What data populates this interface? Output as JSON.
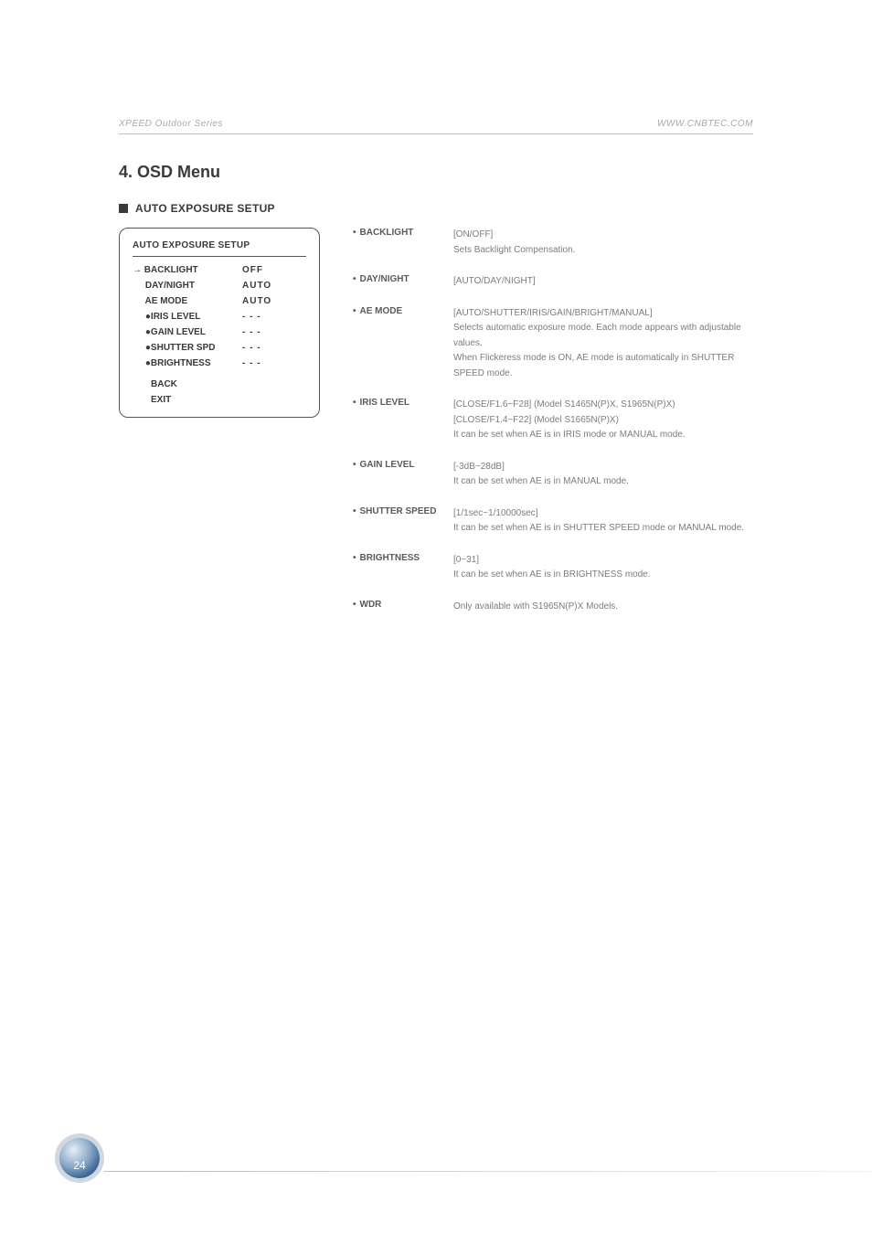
{
  "header": {
    "left": "XPEED Outdoor Series",
    "right": "WWW.CNBTEC.COM"
  },
  "title": "4. OSD Menu",
  "subtitle": "AUTO EXPOSURE SETUP",
  "menu_box": {
    "title": "AUTO EXPOSURE SETUP",
    "rows": [
      {
        "label": "→ BACKLIGHT",
        "value": "OFF"
      },
      {
        "label": "     DAY/NIGHT",
        "value": "AUTO"
      },
      {
        "label": "     AE MODE",
        "value": "AUTO"
      },
      {
        "label": "     ●IRIS LEVEL",
        "value": "- - -"
      },
      {
        "label": "     ●GAIN LEVEL",
        "value": "- - -"
      },
      {
        "label": "     ●SHUTTER SPD",
        "value": "- - -"
      },
      {
        "label": "     ●BRIGHTNESS",
        "value": "- - -"
      }
    ],
    "bottom": [
      {
        "label": "BACK"
      },
      {
        "label": "EXIT"
      }
    ]
  },
  "items": [
    {
      "label": "BACKLIGHT",
      "lines": [
        "[ON/OFF]",
        "Sets Backlight Compensation."
      ]
    },
    {
      "label": "DAY/NIGHT",
      "lines": [
        "[AUTO/DAY/NIGHT]"
      ]
    },
    {
      "label": "AE MODE",
      "lines": [
        "[AUTO/SHUTTER/IRIS/GAIN/BRIGHT/MANUAL]",
        "Selects automatic exposure mode. Each mode appears with adjustable values.",
        "When Flickeress mode is ON, AE mode is automatically in SHUTTER SPEED mode."
      ]
    },
    {
      "label": "IRIS LEVEL",
      "lines": [
        "[CLOSE/F1.6~F28] (Model S1465N(P)X, S1965N(P)X)",
        "[CLOSE/F1.4~F22] (Model S1665N(P)X)",
        "It can be set when AE is in IRIS mode or MANUAL mode."
      ]
    },
    {
      "label": "GAIN LEVEL",
      "lines": [
        "[-3dB~28dB]",
        "It can be set when AE is in MANUAL mode."
      ]
    },
    {
      "label": "SHUTTER SPEED",
      "lines": [
        "[1/1sec~1/10000sec]",
        "It can be set when AE is in SHUTTER SPEED mode or MANUAL mode."
      ]
    },
    {
      "label": "BRIGHTNESS",
      "lines": [
        "[0~31]",
        "It can be set when AE is in BRIGHTNESS mode."
      ]
    },
    {
      "label": "WDR",
      "lines": [
        "Only available with S1965N(P)X Models."
      ]
    }
  ],
  "page_number": "24"
}
